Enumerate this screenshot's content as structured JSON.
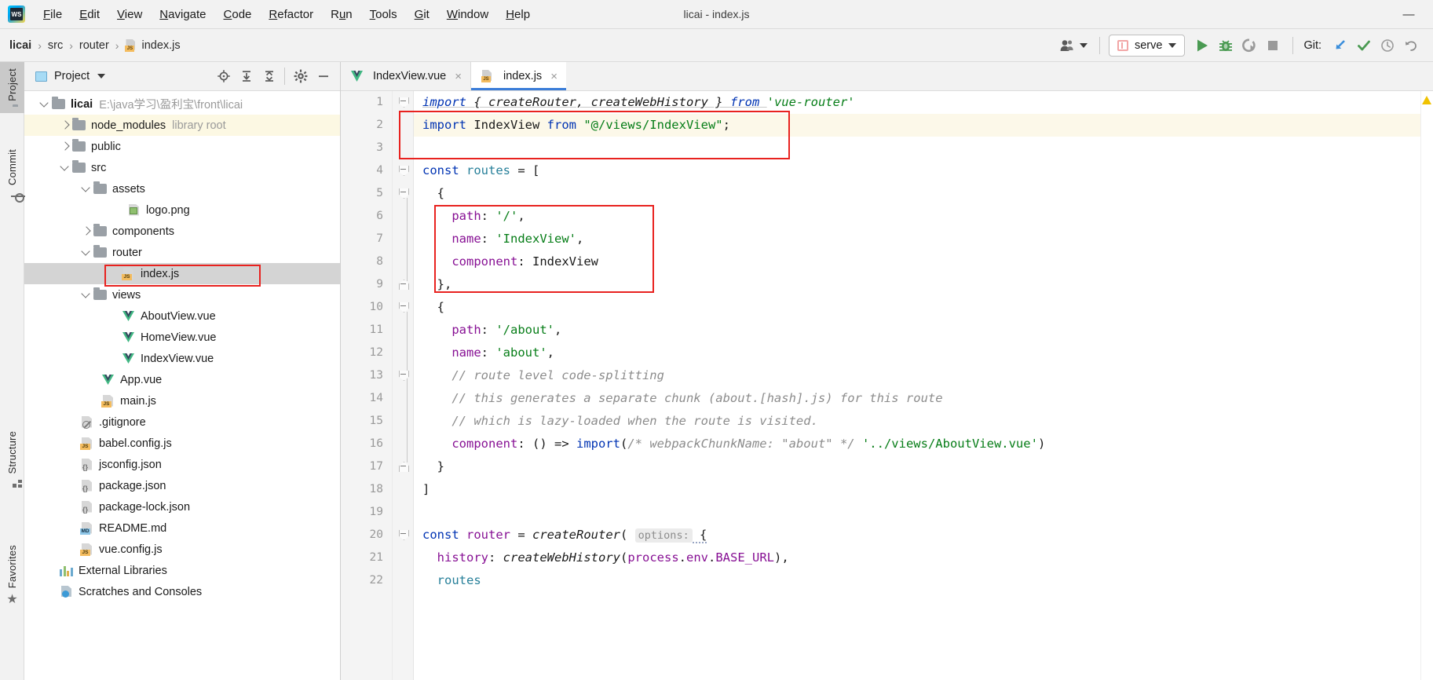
{
  "window": {
    "title": "licai - index.js",
    "minimize_label": "—"
  },
  "menubar": {
    "logo_name": "webstorm-logo",
    "items": [
      {
        "label": "File",
        "mnemonic": "F",
        "rest": "ile"
      },
      {
        "label": "Edit",
        "mnemonic": "E",
        "rest": "dit"
      },
      {
        "label": "View",
        "mnemonic": "V",
        "rest": "iew"
      },
      {
        "label": "Navigate",
        "mnemonic": "N",
        "rest": "avigate"
      },
      {
        "label": "Code",
        "mnemonic": "C",
        "rest": "ode"
      },
      {
        "label": "Refactor",
        "mnemonic": "R",
        "rest": "efactor"
      },
      {
        "label": "Run",
        "mnemonic": "R",
        "rest": "un"
      },
      {
        "label": "Tools",
        "mnemonic": "T",
        "rest": "ools"
      },
      {
        "label": "Git",
        "mnemonic": "G",
        "rest": "it"
      },
      {
        "label": "Window",
        "mnemonic": "W",
        "rest": "indow"
      },
      {
        "label": "Help",
        "mnemonic": "H",
        "rest": "elp"
      }
    ]
  },
  "breadcrumb": {
    "project": "licai",
    "parts": [
      "src",
      "router"
    ],
    "file": "index.js",
    "separator": "›"
  },
  "toolbar": {
    "user_icon": "user-group-icon",
    "run_config": "serve",
    "run_label": "run-button",
    "debug_label": "debug-button",
    "profile_label": "run-with-coverage-button",
    "stop_label": "stop-button",
    "git_label": "Git:",
    "git_update": "update-project-icon",
    "git_commit": "commit-icon",
    "git_history": "history-icon",
    "git_rollback": "rollback-icon",
    "colors": {
      "run_green": "#4a9a52",
      "git_blue": "#3a8edb",
      "check_green": "#4a9a52",
      "tab_underline": "#3b7dd8",
      "annotation_red": "#e8221f"
    }
  },
  "left_strip": {
    "tabs": [
      {
        "label": "Project",
        "icon": "folder-icon",
        "active": true
      },
      {
        "label": "Commit",
        "icon": "commit-icon",
        "active": false
      },
      {
        "label": "Structure",
        "icon": "structure-icon",
        "active": false
      },
      {
        "label": "Favorites",
        "icon": "star-icon",
        "active": false
      }
    ]
  },
  "project_panel": {
    "title": "Project",
    "actions": [
      "locate-icon",
      "expand-all-icon",
      "collapse-all-icon",
      "settings-gear-icon",
      "hide-icon"
    ],
    "tree": [
      {
        "label": "licai",
        "dim": "E:\\java学习\\盈利宝\\front\\licai",
        "indent": 0,
        "arrow": "down",
        "icon": "folder",
        "bold": true
      },
      {
        "label": "node_modules",
        "dim": "library root",
        "indent": 1,
        "arrow": "right",
        "icon": "folder",
        "highlight": "library"
      },
      {
        "label": "public",
        "indent": 1,
        "arrow": "right",
        "icon": "folder"
      },
      {
        "label": "src",
        "indent": 1,
        "arrow": "down",
        "icon": "folder"
      },
      {
        "label": "assets",
        "indent": 2,
        "arrow": "down",
        "icon": "folder"
      },
      {
        "label": "logo.png",
        "indent": 3,
        "arrow": "none",
        "icon": "image"
      },
      {
        "label": "components",
        "indent": 2,
        "arrow": "right",
        "icon": "folder"
      },
      {
        "label": "router",
        "indent": 2,
        "arrow": "down",
        "icon": "folder"
      },
      {
        "label": "index.js",
        "indent": 3,
        "arrow": "none",
        "icon": "js",
        "selected": true,
        "annotated": true
      },
      {
        "label": "views",
        "indent": 2,
        "arrow": "down",
        "icon": "folder"
      },
      {
        "label": "AboutView.vue",
        "indent": 3,
        "arrow": "none",
        "icon": "vue"
      },
      {
        "label": "HomeView.vue",
        "indent": 3,
        "arrow": "none",
        "icon": "vue"
      },
      {
        "label": "IndexView.vue",
        "indent": 3,
        "arrow": "none",
        "icon": "vue"
      },
      {
        "label": "App.vue",
        "indent": 2,
        "arrow": "none",
        "icon": "vue"
      },
      {
        "label": "main.js",
        "indent": 2,
        "arrow": "none",
        "icon": "js"
      },
      {
        "label": ".gitignore",
        "indent": 1,
        "arrow": "none",
        "icon": "gitignore"
      },
      {
        "label": "babel.config.js",
        "indent": 1,
        "arrow": "none",
        "icon": "js"
      },
      {
        "label": "jsconfig.json",
        "indent": 1,
        "arrow": "none",
        "icon": "json"
      },
      {
        "label": "package.json",
        "indent": 1,
        "arrow": "none",
        "icon": "json"
      },
      {
        "label": "package-lock.json",
        "indent": 1,
        "arrow": "none",
        "icon": "json"
      },
      {
        "label": "README.md",
        "indent": 1,
        "arrow": "none",
        "icon": "md"
      },
      {
        "label": "vue.config.js",
        "indent": 1,
        "arrow": "none",
        "icon": "js"
      },
      {
        "label": "External Libraries",
        "indent": 0,
        "arrow": "none",
        "icon": "extlib"
      },
      {
        "label": "Scratches and Consoles",
        "indent": 0,
        "arrow": "none",
        "icon": "scratch"
      }
    ]
  },
  "editor": {
    "tabs": [
      {
        "label": "IndexView.vue",
        "icon": "vue-icon",
        "active": false,
        "close": "×"
      },
      {
        "label": "index.js",
        "icon": "js-icon",
        "active": true,
        "close": "×"
      }
    ],
    "line_numbers": [
      1,
      2,
      3,
      4,
      5,
      6,
      7,
      8,
      9,
      10,
      11,
      12,
      13,
      14,
      15,
      16,
      17,
      18,
      19,
      20,
      21,
      22
    ],
    "current_line": 2,
    "code_lines": [
      "import { createRouter, createWebHistory } from 'vue-router'",
      "import IndexView from \"@/views/IndexView\";",
      "",
      "const routes = [",
      "  {",
      "    path: '/',",
      "    name: 'IndexView',",
      "    component: IndexView",
      "  },",
      "  {",
      "    path: '/about',",
      "    name: 'about',",
      "    // route level code-splitting",
      "    // this generates a separate chunk (about.[hash].js) for this route",
      "    // which is lazy-loaded when the route is visited.",
      "    component: () => import(/* webpackChunkName: \"about\" */ '../views/AboutView.vue')",
      "  }",
      "]",
      "",
      "const router = createRouter( options: {",
      "  history: createWebHistory(process.env.BASE_URL),",
      "  routes"
    ],
    "inlay_hint": "options:",
    "warning_icon": "warning-triangle-icon"
  }
}
